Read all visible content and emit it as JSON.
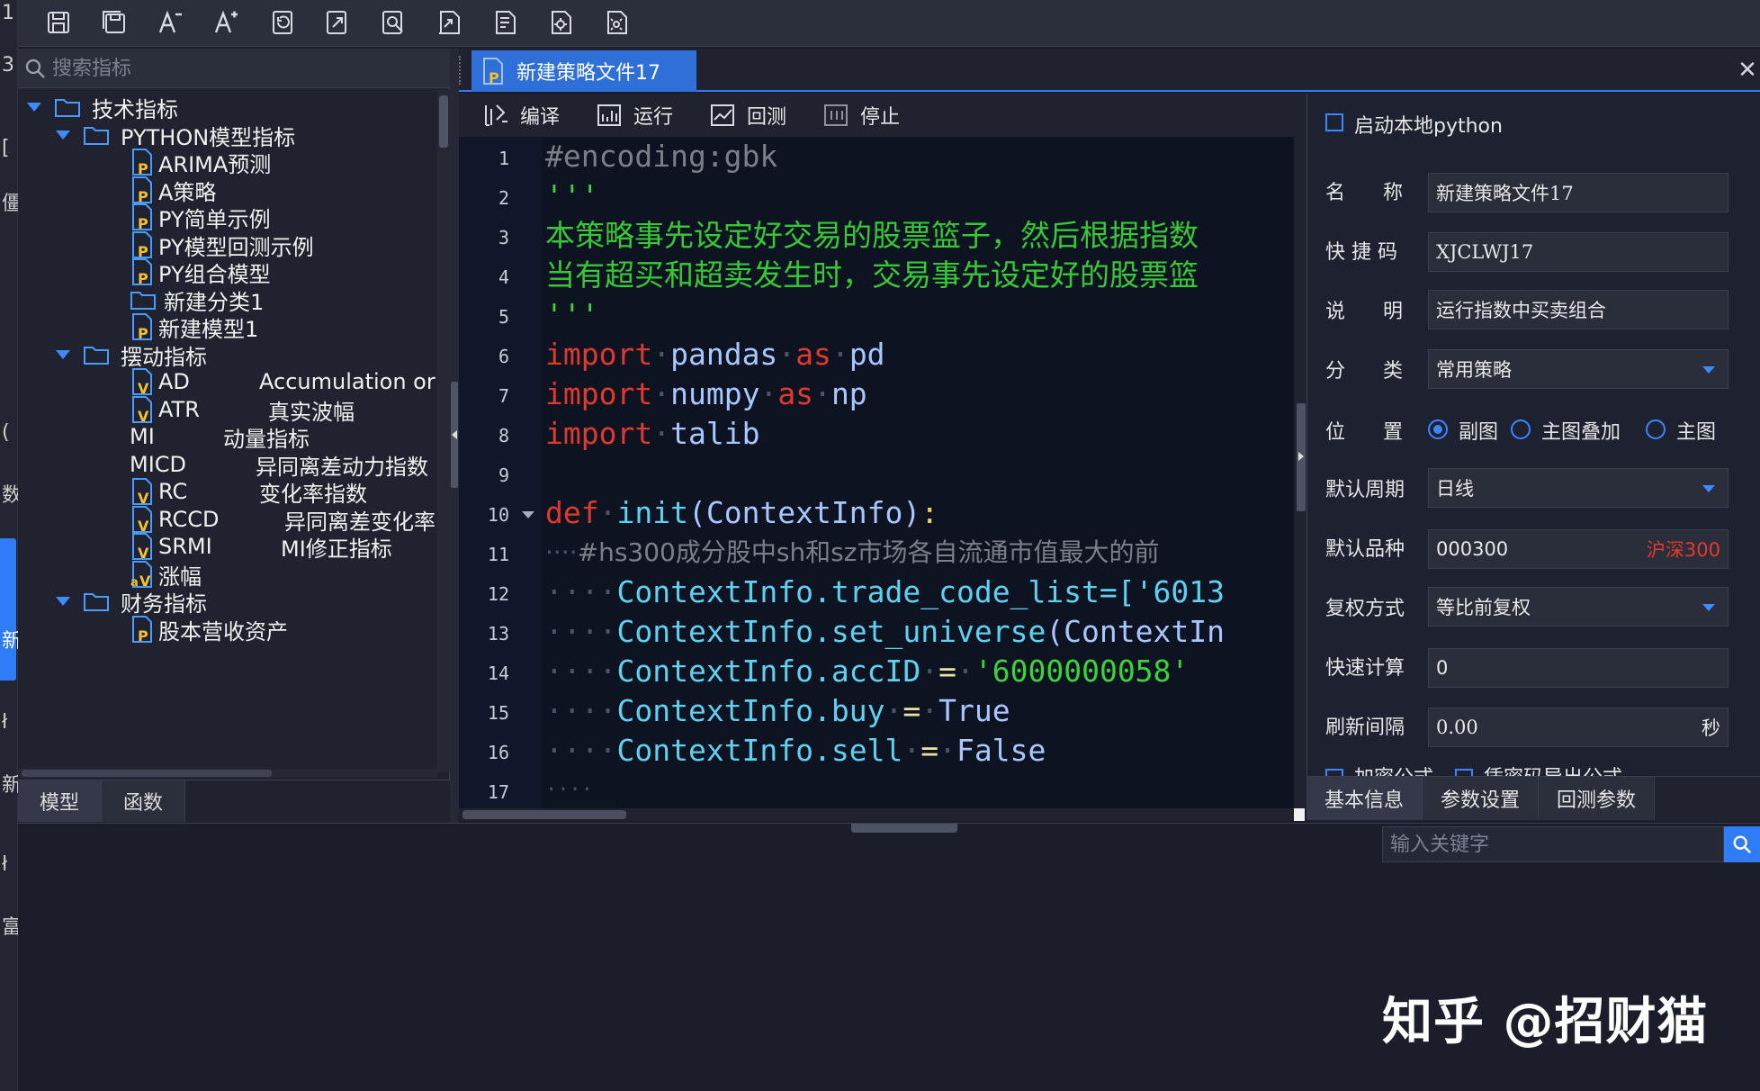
{
  "left_strip": {
    "fragments": [
      "1",
      "3",
      "[",
      "僵",
      "(",
      "数",
      "新",
      "ł",
      "新",
      "ł",
      "富"
    ]
  },
  "toolbar": {
    "buttons": [
      "save-icon",
      "save-all-icon",
      "font-decrease-icon",
      "font-increase-icon",
      "undo-icon",
      "redo-icon",
      "find-icon",
      "export-icon",
      "import-icon",
      "settings-icon",
      "config-icon"
    ]
  },
  "search": {
    "placeholder": "搜索指标"
  },
  "tree": {
    "root": "技术指标",
    "python_folder": "PYTHON模型指标",
    "python_items": [
      "ARIMA预测",
      "A策略",
      "PY简单示例",
      "PY模型回测示例",
      "PY组合模型"
    ],
    "new_category": "新建分类1",
    "new_model": "新建模型1",
    "osc_folder": "摆动指标",
    "osc_items": [
      {
        "name": "AD",
        "desc": "Accumulation or"
      },
      {
        "name": "ATR",
        "desc": "真实波幅"
      },
      {
        "name": "MI",
        "desc": "动量指标"
      },
      {
        "name": "MICD",
        "desc": "异同离差动力指数"
      },
      {
        "name": "RC",
        "desc": "变化率指数"
      },
      {
        "name": "RCCD",
        "desc": "异同离差变化率"
      },
      {
        "name": "SRMI",
        "desc": "MI修正指标"
      },
      {
        "name": "涨幅",
        "desc": ""
      }
    ],
    "fin_folder": "财务指标",
    "fin_items": [
      "股本营收资产"
    ]
  },
  "left_tabs": [
    "模型",
    "函数"
  ],
  "doc_tab": {
    "title": "新建策略文件17"
  },
  "editor_toolbar": {
    "compile": "编译",
    "run": "运行",
    "backtest": "回测",
    "stop": "停止"
  },
  "code": {
    "line_numbers": [
      "1",
      "2",
      "3",
      "4",
      "5",
      "6",
      "7",
      "8",
      "9",
      "10",
      "11",
      "12",
      "13",
      "14",
      "15",
      "16",
      "17"
    ],
    "l1": "#encoding:gbk",
    "l2": "'''",
    "l3": "本策略事先设定好交易的股票篮子，然后根据指数",
    "l4": "当有超买和超卖发生时，交易事先设定好的股票篮",
    "l5": "'''",
    "l11_comment": "#hs300成分股中sh和sz市场各自流通市值最大的前",
    "l12_a": "ContextInfo.trade_code_list=['6013",
    "l13_a": "ContextInfo.set_universe",
    "l13_b": "(ContextIn",
    "l14_a": "ContextInfo.accID",
    "l14_b": "'6000000058'",
    "l15_a": "ContextInfo.buy",
    "l15_b": "True",
    "l16_a": "ContextInfo.sell",
    "l16_b": "False",
    "kw_import": "import",
    "kw_as": "as",
    "kw_def": "def",
    "mod_pandas": "pandas",
    "alias_pd": "pd",
    "mod_numpy": "numpy",
    "alias_np": "np",
    "mod_talib": "talib",
    "fn_init": "init",
    "param": "(ContextInfo)",
    "colon": ":",
    "eq": "=",
    "indent": "····",
    "dot": "·"
  },
  "props": {
    "local_python": "启动本地python",
    "name_label_a": "名",
    "name_label_b": "称",
    "name_value": "新建策略文件17",
    "code_label": "快 捷 码",
    "code_value": "XJCLWJ17",
    "desc_label_a": "说",
    "desc_label_b": "明",
    "desc_value": "运行指数中买卖组合",
    "cat_label_a": "分",
    "cat_label_b": "类",
    "cat_value": "常用策略",
    "pos_label_a": "位",
    "pos_label_b": "置",
    "pos_options": [
      "副图",
      "主图叠加",
      "主图"
    ],
    "period_label": "默认周期",
    "period_value": "日线",
    "symbol_label": "默认品种",
    "symbol_value": "000300",
    "symbol_name": "沪深300",
    "adjust_label": "复权方式",
    "adjust_value": "等比前复权",
    "fastcalc_label": "快速计算",
    "fastcalc_value": "0",
    "refresh_label": "刷新间隔",
    "refresh_value": "0.00",
    "refresh_unit": "秒",
    "encrypt": "加密公式",
    "export_pw": "凭密码导出公式"
  },
  "prop_tabs": [
    "基本信息",
    "参数设置",
    "回测参数"
  ],
  "keyword": {
    "placeholder": "输入关键字"
  },
  "watermark": "知乎 @招财猫",
  "colors": {
    "accent": "#2f7cf6",
    "keyword": "#e0392e",
    "string": "#3bd23b",
    "comment": "#7d7f88",
    "bg": "#1b1e2a"
  }
}
